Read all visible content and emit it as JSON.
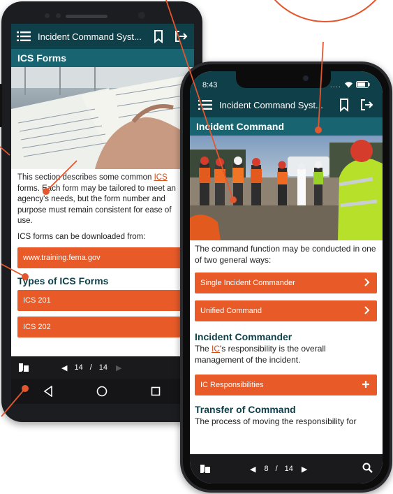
{
  "back_phone": {
    "header": {
      "title": "Incident Command Syst...",
      "icons": [
        "menu-icon",
        "bookmark-icon",
        "exit-icon"
      ]
    },
    "section_title": "ICS Forms",
    "body_before_link": "This section describes some common ",
    "body_link": "ICS",
    "body_after_link": " forms. Each form may  be tailored to meet an agency's needs, but the form number and purpose must remain consistent for ease of use.",
    "download_text": "ICS forms can be downloaded from:",
    "download_link": "www.training.fema.gov",
    "subheading": "Types of ICS Forms",
    "forms": [
      "ICS 201",
      "ICS 202"
    ],
    "pager": {
      "current": "14",
      "separator": "/",
      "total": "14"
    },
    "android_nav": [
      "back-icon",
      "home-icon",
      "recents-icon"
    ]
  },
  "front_phone": {
    "status": {
      "time": "8:43"
    },
    "header": {
      "title": "Incident Command Syst...",
      "icons": [
        "menu-icon",
        "bookmark-icon",
        "exit-icon"
      ]
    },
    "section_title": "Incident Command",
    "intro": "The command function may be conducted in one of two general  ways:",
    "options": [
      {
        "label": "Single Incident Commander",
        "icon": "chevron-right-icon"
      },
      {
        "label": "Unified Command",
        "icon": "chevron-right-icon"
      }
    ],
    "commander_heading": "Incident Commander",
    "commander_before_link": "The ",
    "commander_link": "IC",
    "commander_after_link": "'s responsibility is the overall management of the incident.",
    "responsibilities_label": "IC Responsibilities",
    "responsibilities_icon": "plus-icon",
    "transfer_heading": "Transfer of Command",
    "transfer_text": "The process of moving the responsibility for",
    "pager": {
      "current": "8",
      "separator": "/",
      "total": "14"
    }
  },
  "colors": {
    "header_dark": "#0f3f48",
    "section_teal": "#186571",
    "accent_orange": "#e85b29",
    "callout_orange": "#e4572e",
    "pager_black": "#1a1a1c"
  }
}
